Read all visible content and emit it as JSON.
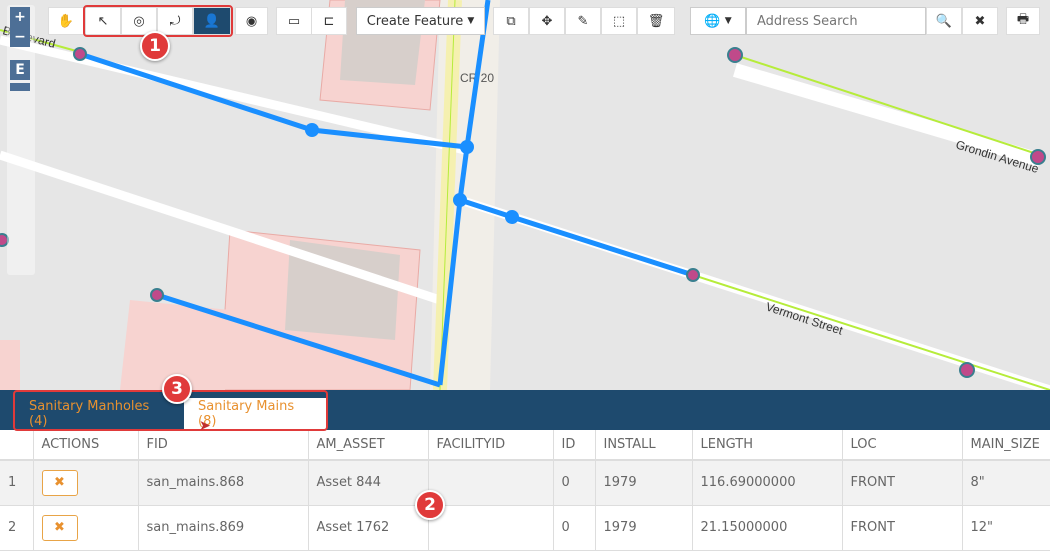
{
  "map": {
    "road_labels": [
      "Grondin Avenue",
      "Vermont Street",
      "CR 20",
      "Boulevard"
    ],
    "zoom_in": "+",
    "zoom_out": "−",
    "extent": "E"
  },
  "toolbar": {
    "pan": "✋",
    "select": "↖",
    "select_circle": "◎",
    "select_lasso": "⤾",
    "select_user": "👤",
    "target": "◉",
    "measure": "▭",
    "measure2": "⊏",
    "create_feature": "Create Feature",
    "tools": [
      "⧉",
      "✥",
      "✎",
      "⬚",
      "🗑"
    ],
    "globe": "🌐",
    "address_placeholder": "Address Search",
    "search": "🔍",
    "clear": "✖",
    "print": "🖶"
  },
  "callouts": [
    "1",
    "2",
    "3"
  ],
  "panel": {
    "tabs": [
      {
        "label": "Sanitary Manholes (4)"
      },
      {
        "label": "Sanitary Mains (8)"
      }
    ],
    "columns": [
      "",
      "ACTIONS",
      "FID",
      "AM_ASSET",
      "FACILITYID",
      "ID",
      "INSTALL",
      "LENGTH",
      "LOC",
      "MAIN_SIZE"
    ],
    "rows": [
      [
        "1",
        "✖",
        "san_mains.868",
        "Asset 844",
        "",
        "0",
        "1979",
        "116.69000000",
        "FRONT",
        "8\""
      ],
      [
        "2",
        "✖",
        "san_mains.869",
        "Asset 1762",
        "",
        "0",
        "1979",
        "21.15000000",
        "FRONT",
        "12\""
      ]
    ]
  }
}
